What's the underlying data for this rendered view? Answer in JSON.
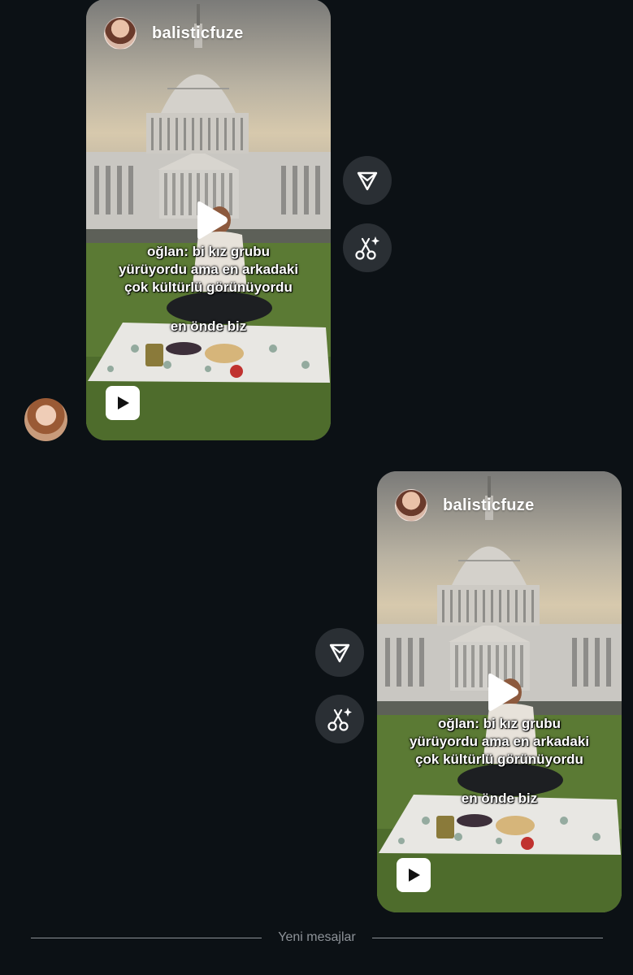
{
  "messages": [
    {
      "direction": "incoming",
      "reel": {
        "username": "balisticfuze",
        "caption_lines": [
          "oğlan: bi kız grubu",
          "yürüyordu ama en arkadaki",
          "çok kültürlü görünüyordu"
        ],
        "caption_sub": "en önde biz",
        "play_icon": "play-icon",
        "reels_badge_icon": "reels-play-icon"
      },
      "actions": [
        "share-icon",
        "ai-remix-icon"
      ]
    },
    {
      "direction": "outgoing",
      "reel": {
        "username": "balisticfuze",
        "caption_lines": [
          "oğlan: bi kız grubu",
          "yürüyordu ama en arkadaki",
          "çok kültürlü görünüyordu"
        ],
        "caption_sub": "en önde biz",
        "play_icon": "play-icon",
        "reels_badge_icon": "reels-play-icon"
      },
      "actions": [
        "share-icon",
        "ai-remix-icon"
      ]
    }
  ],
  "divider": {
    "label": "Yeni mesajlar"
  },
  "colors": {
    "background": "#0c1115",
    "action_button": "#2a2f34",
    "divider_text": "#8e9399"
  }
}
